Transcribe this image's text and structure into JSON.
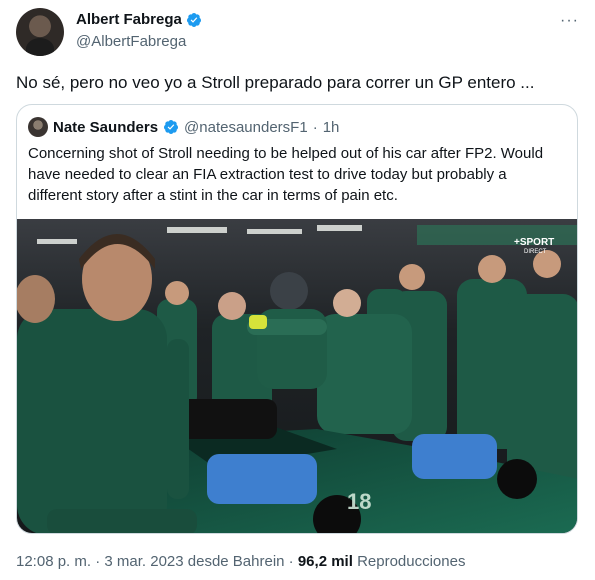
{
  "tweet": {
    "author_name": "Albert Fabrega",
    "author_handle": "@AlbertFabrega",
    "more_label": "···",
    "text": "No sé, pero no veo yo a Stroll preparado para correr un GP entero ..."
  },
  "quote": {
    "author_name": "Nate Saunders",
    "author_handle": "@natesaundersF1",
    "separator": "·",
    "time": "1h",
    "text": "Concerning shot of Stroll needing to be helped out of his car after FP2. Would have needed to clear an FIA extraction test to drive today but probably a different story after a stint in the car in terms of pain etc.",
    "media_watermark": "+SPORT",
    "media_watermark_sub": "DIRECT"
  },
  "footer": {
    "timestamp": "12:08 p. m. · 3 mar. 2023 desde Bahrein ·",
    "views_count": "96,2 mil",
    "views_label": "Reproducciones"
  },
  "colors": {
    "verified_blue": "#1d9bf0",
    "team_green": "#1e5a46",
    "text_secondary": "#536471"
  },
  "icons": [
    "verified-badge-icon",
    "more-options-icon"
  ]
}
